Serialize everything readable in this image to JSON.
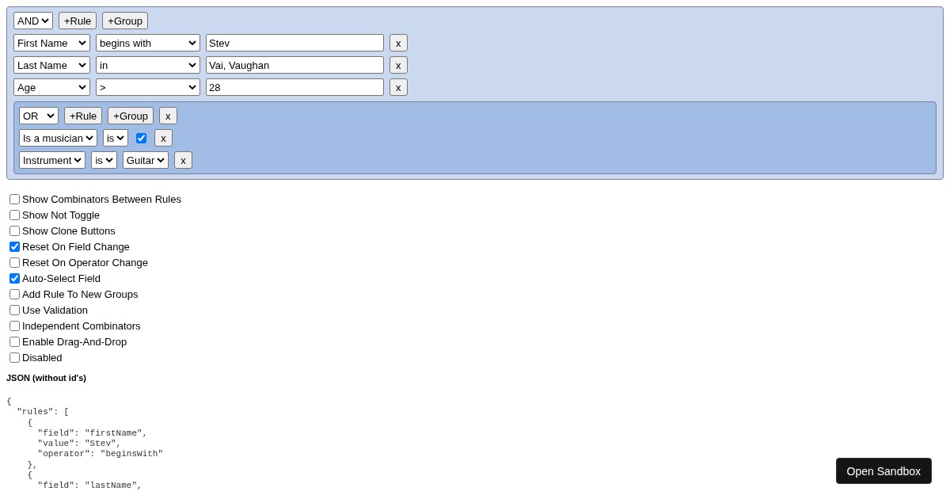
{
  "query": {
    "combinator": "AND",
    "add_rule": "+Rule",
    "add_group": "+Group",
    "rules": [
      {
        "kind": "rule",
        "field": "First Name",
        "operator": "begins with",
        "value": {
          "kind": "text",
          "text": "Stev"
        },
        "remove": "x"
      },
      {
        "kind": "rule",
        "field": "Last Name",
        "operator": "in",
        "value": {
          "kind": "text",
          "text": "Vai, Vaughan"
        },
        "remove": "x"
      },
      {
        "kind": "rule",
        "field": "Age",
        "operator": ">",
        "value": {
          "kind": "text",
          "text": "28"
        },
        "remove": "x"
      },
      {
        "kind": "group",
        "combinator": "OR",
        "add_rule": "+Rule",
        "add_group": "+Group",
        "remove": "x",
        "rules": [
          {
            "kind": "rule",
            "field": "Is a musician",
            "operator": "is",
            "value": {
              "kind": "checkbox",
              "checked": true
            },
            "remove": "x"
          },
          {
            "kind": "rule",
            "field": "Instrument",
            "operator": "is",
            "value": {
              "kind": "select",
              "text": "Guitar"
            },
            "remove": "x"
          }
        ]
      }
    ]
  },
  "options": [
    {
      "label": "Show Combinators Between Rules",
      "checked": false
    },
    {
      "label": "Show Not Toggle",
      "checked": false
    },
    {
      "label": "Show Clone Buttons",
      "checked": false
    },
    {
      "label": "Reset On Field Change",
      "checked": true
    },
    {
      "label": "Reset On Operator Change",
      "checked": false
    },
    {
      "label": "Auto-Select Field",
      "checked": true
    },
    {
      "label": "Add Rule To New Groups",
      "checked": false
    },
    {
      "label": "Use Validation",
      "checked": false
    },
    {
      "label": "Independent Combinators",
      "checked": false
    },
    {
      "label": "Enable Drag-And-Drop",
      "checked": false
    },
    {
      "label": "Disabled",
      "checked": false
    }
  ],
  "json_heading": "JSON (without id's)",
  "json_lines": [
    "{",
    "  \"rules\": [",
    "    {",
    "      \"field\": \"firstName\",",
    "      \"value\": \"Stev\",",
    "      \"operator\": \"beginsWith\"",
    "    },",
    "    {",
    "      \"field\": \"lastName\","
  ],
  "sandbox_button": "Open Sandbox"
}
